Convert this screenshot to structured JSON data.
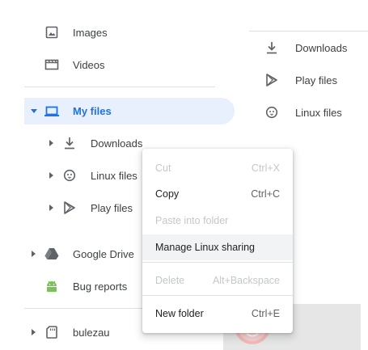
{
  "sidebar": {
    "images": "Images",
    "videos": "Videos",
    "my_files": "My files",
    "downloads": "Downloads",
    "linux_files": "Linux files",
    "play_files": "Play files",
    "google_drive": "Google Drive",
    "bug_reports": "Bug reports",
    "usb": "bulezau"
  },
  "main_list": {
    "downloads": "Downloads",
    "play_files": "Play files",
    "linux_files": "Linux files"
  },
  "context_menu": {
    "cut": "Cut",
    "cut_shortcut": "Ctrl+X",
    "copy": "Copy",
    "copy_shortcut": "Ctrl+C",
    "paste_into_folder": "Paste into folder",
    "manage_linux_sharing": "Manage Linux sharing",
    "delete": "Delete",
    "delete_shortcut": "Alt+Backspace",
    "new_folder": "New folder",
    "new_folder_shortcut": "Ctrl+E"
  },
  "colors": {
    "accent": "#1a73e8",
    "selected_bg": "#e8f0fe",
    "icon": "#5f6368",
    "android_green": "#78c257"
  }
}
